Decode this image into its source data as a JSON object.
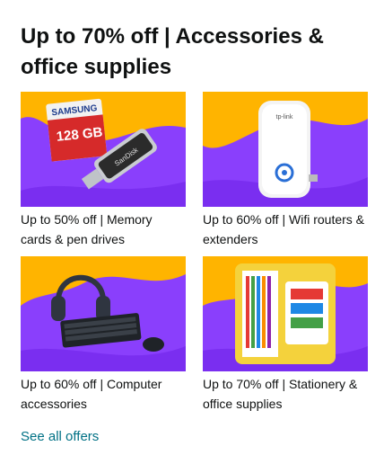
{
  "card": {
    "title": "Up to 70% off | Accessories & office supplies",
    "see_all": "See all offers",
    "tiles": [
      {
        "label": "Up to 50% off | Memory cards & pen drives",
        "image": "memory-card-and-pen-drive-image",
        "brand_text": "SAMSUNG",
        "card_text": "128 GB",
        "drive_text": "SanDisk"
      },
      {
        "label": "Up to 60% off | Wifi routers & extenders",
        "image": "wifi-extender-image",
        "brand_text": "tp-link"
      },
      {
        "label": "Up to 60% off | Computer accessories",
        "image": "headphones-keyboard-mouse-image"
      },
      {
        "label": "Up to 70% off | Stationery & office supplies",
        "image": "stationery-kit-image"
      }
    ]
  },
  "colors": {
    "background_purple": "#8a3ffc",
    "background_yellow": "#ffb400",
    "link": "#007185",
    "text": "#0f1111"
  }
}
